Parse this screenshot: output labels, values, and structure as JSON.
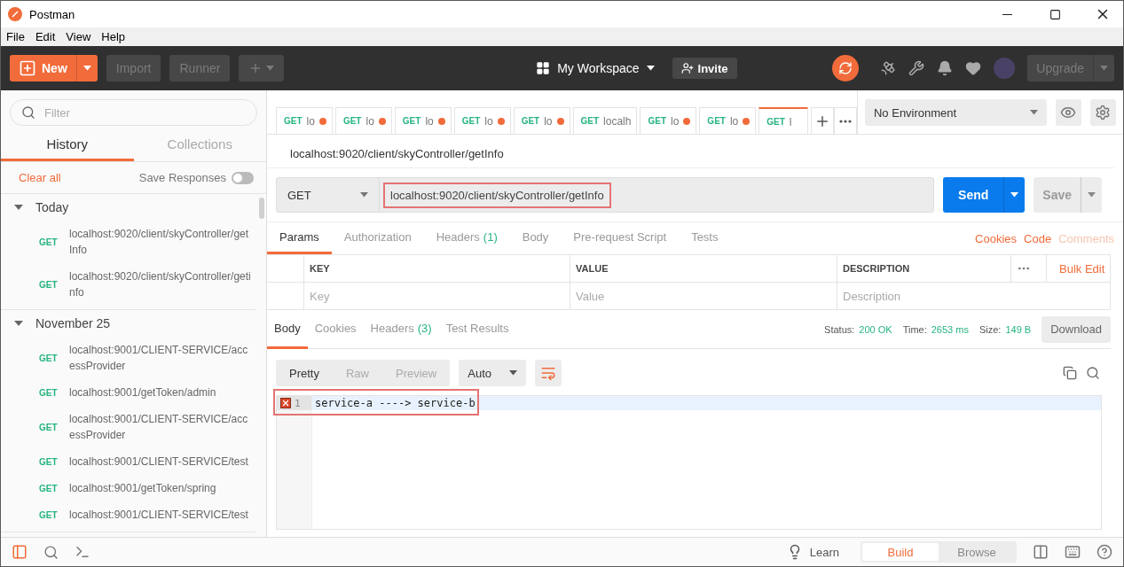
{
  "window": {
    "title": "Postman"
  },
  "menu": [
    "File",
    "Edit",
    "View",
    "Help"
  ],
  "toolbar": {
    "new": "New",
    "import": "Import",
    "runner": "Runner",
    "workspace": "My Workspace",
    "invite": "Invite",
    "upgrade": "Upgrade"
  },
  "sidebar": {
    "filter": {
      "placeholder": "Filter"
    },
    "tabs": [
      {
        "label": "History",
        "selected": true
      },
      {
        "label": "Collections",
        "selected": false
      }
    ],
    "clear_all": "Clear all",
    "save_responses": {
      "label": "Save Responses",
      "on": false
    },
    "groups": [
      {
        "title": "Today",
        "expanded": true,
        "items": [
          {
            "method": "GET",
            "url": "localhost:9020/client/skyController/getInfo"
          },
          {
            "method": "GET",
            "url": "localhost:9020/client/skyController/getinfo"
          }
        ]
      },
      {
        "title": "November 25",
        "expanded": true,
        "items": [
          {
            "method": "GET",
            "url": "localhost:9001/CLIENT-SERVICE/accessProvider"
          },
          {
            "method": "GET",
            "url": "localhost:9001/getToken/admin"
          },
          {
            "method": "GET",
            "url": "localhost:9001/CLIENT-SERVICE/accessProvider"
          },
          {
            "method": "GET",
            "url": "localhost:9001/CLIENT-SERVICE/test"
          },
          {
            "method": "GET",
            "url": "localhost:9001/getToken/spring"
          },
          {
            "method": "GET",
            "url": "localhost:9001/CLIENT-SERVICE/test"
          }
        ]
      }
    ]
  },
  "request_tabs": [
    {
      "method": "GET",
      "name": "lo",
      "dirty": true,
      "selected": false
    },
    {
      "method": "GET",
      "name": "lo",
      "dirty": true,
      "selected": false
    },
    {
      "method": "GET",
      "name": "lo",
      "dirty": true,
      "selected": false
    },
    {
      "method": "GET",
      "name": "lo",
      "dirty": true,
      "selected": false
    },
    {
      "method": "GET",
      "name": "lo",
      "dirty": true,
      "selected": false
    },
    {
      "method": "GET",
      "name": "localh",
      "dirty": false,
      "selected": false
    },
    {
      "method": "GET",
      "name": "lo",
      "dirty": true,
      "selected": false
    },
    {
      "method": "GET",
      "name": "lo",
      "dirty": true,
      "selected": false
    },
    {
      "method": "GET",
      "name": "l",
      "dirty": false,
      "selected": true
    }
  ],
  "environment": "No Environment",
  "request": {
    "title": "localhost:9020/client/skyController/getInfo",
    "method": "GET",
    "url": "localhost:9020/client/skyController/getInfo",
    "highlighted": true,
    "send": "Send",
    "save": "Save"
  },
  "request_subtabs": [
    {
      "label": "Params",
      "selected": true
    },
    {
      "label": "Authorization",
      "selected": false
    },
    {
      "label": "Headers",
      "count": "(1)",
      "selected": false
    },
    {
      "label": "Body",
      "selected": false
    },
    {
      "label": "Pre-request Script",
      "selected": false
    },
    {
      "label": "Tests",
      "selected": false
    }
  ],
  "request_links": [
    {
      "label": "Cookies",
      "disabled": false
    },
    {
      "label": "Code",
      "disabled": false
    },
    {
      "label": "Comments",
      "disabled": true
    }
  ],
  "params": {
    "columns": [
      "KEY",
      "VALUE",
      "DESCRIPTION"
    ],
    "bulk_edit": "Bulk Edit",
    "placeholders": [
      "Key",
      "Value",
      "Description"
    ]
  },
  "response_tabs": [
    {
      "label": "Body",
      "selected": true
    },
    {
      "label": "Cookies",
      "selected": false
    },
    {
      "label": "Headers",
      "count": "(3)",
      "selected": false
    },
    {
      "label": "Test Results",
      "selected": false
    }
  ],
  "response_status": [
    {
      "label": "Status:",
      "value": "200 OK"
    },
    {
      "label": "Time:",
      "value": "2653 ms"
    },
    {
      "label": "Size:",
      "value": "149 B"
    }
  ],
  "download": "Download",
  "view_modes": [
    {
      "label": "Pretty",
      "selected": true
    },
    {
      "label": "Raw",
      "selected": false
    },
    {
      "label": "Preview",
      "selected": false
    }
  ],
  "format": "Auto",
  "code_lines": [
    {
      "number": "1",
      "text": "service-a ----> service-b",
      "error": true,
      "highlighted": true
    }
  ],
  "status_bar": {
    "learn": "Learn",
    "modes": [
      {
        "label": "Build",
        "selected": true
      },
      {
        "label": "Browse",
        "selected": false
      }
    ]
  }
}
